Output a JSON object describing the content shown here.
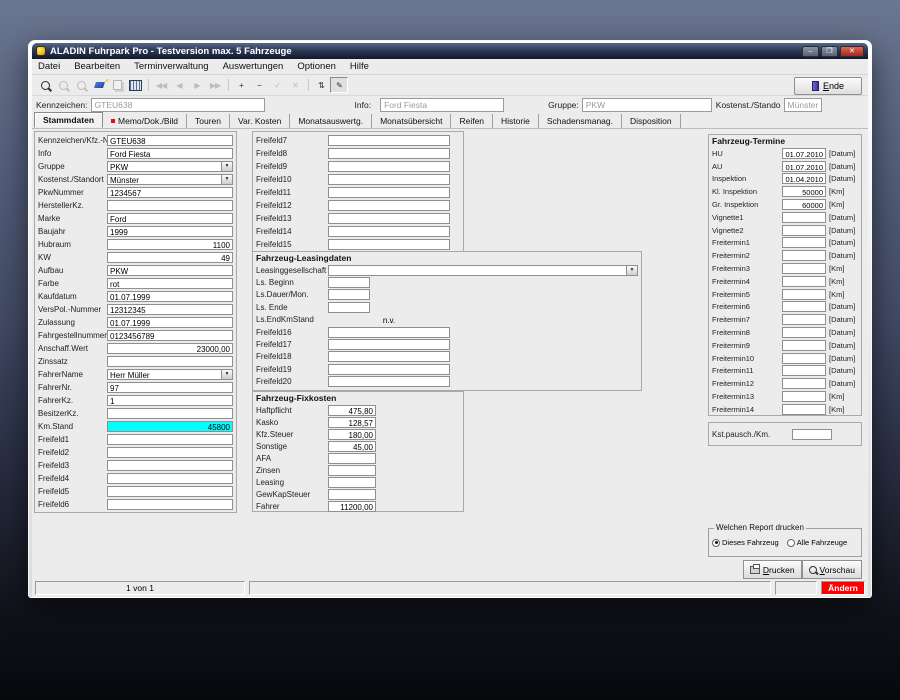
{
  "colors": {
    "highlight_field": "#00ffff",
    "mode_badge_bg": "#ff0000",
    "titlebar_dark": "#10182a",
    "tab_marker_red": "#dd1111"
  },
  "window": {
    "title": "ALADIN Fuhrpark Pro - Testversion  max. 5 Fahrzeuge",
    "minimize_glyph": "–",
    "maximize_glyph": "❐",
    "close_glyph": "✕"
  },
  "menu": {
    "items": [
      {
        "label": "Datei"
      },
      {
        "label": "Bearbeiten"
      },
      {
        "label": "Terminverwaltung"
      },
      {
        "label": "Auswertungen"
      },
      {
        "label": "Optionen"
      },
      {
        "label": "Hilfe"
      }
    ]
  },
  "toolbar": {
    "items": [
      {
        "name": "search-button",
        "icon": "magnifier",
        "enabled": true
      },
      {
        "name": "find-next-button",
        "icon": "magnifier",
        "enabled": false
      },
      {
        "name": "find-record-button",
        "icon": "magnifier",
        "enabled": false
      },
      {
        "name": "erase-button",
        "icon": "eraser",
        "enabled": true
      },
      {
        "name": "copy-button",
        "icon": "copy",
        "enabled": false
      },
      {
        "name": "table-button",
        "icon": "grid",
        "enabled": true
      },
      {
        "sep": true
      },
      {
        "name": "nav-first-button",
        "glyph": "◀◀",
        "enabled": false
      },
      {
        "name": "nav-prev-button",
        "glyph": "◀",
        "enabled": false
      },
      {
        "name": "nav-next-button",
        "glyph": "▶",
        "enabled": false
      },
      {
        "name": "nav-last-button",
        "glyph": "▶▶",
        "enabled": false
      },
      {
        "sep": true
      },
      {
        "name": "add-record-button",
        "glyph": "+",
        "enabled": true
      },
      {
        "name": "delete-record-button",
        "glyph": "−",
        "enabled": true
      },
      {
        "name": "confirm-button",
        "glyph": "✓",
        "enabled": false
      },
      {
        "name": "cancel-button",
        "glyph": "✕",
        "enabled": false
      },
      {
        "sep": true
      },
      {
        "name": "exchange-button",
        "glyph": "⇅",
        "enabled": true
      },
      {
        "name": "edit-mode-button",
        "glyph": "✎",
        "enabled": true,
        "pressed": true
      }
    ],
    "ende_button": {
      "hotkey": "E",
      "rest": "nde"
    }
  },
  "header_fields": [
    {
      "label": "Kennzeichen:",
      "value": "GTEU638"
    },
    {
      "label": "Info:",
      "value": "Ford Fiesta"
    },
    {
      "label": "Gruppe:",
      "value": "PKW"
    },
    {
      "label": "Kostenst./Stando",
      "value": "Münster"
    }
  ],
  "tabs": [
    {
      "label": "Stammdaten",
      "active": true
    },
    {
      "label": "Memo/Dok./Bild",
      "marker": true
    },
    {
      "label": "Touren"
    },
    {
      "label": "Var. Kosten"
    },
    {
      "label": "Monatsauswertg."
    },
    {
      "label": "Monatsübersicht"
    },
    {
      "label": "Reifen"
    },
    {
      "label": "Historie"
    },
    {
      "label": "Schadensmanag."
    },
    {
      "label": "Disposition"
    }
  ],
  "stammdaten": {
    "rows": [
      {
        "label": "Kennzeichen/Kfz.-Nr.",
        "value": "GTEU638"
      },
      {
        "label": "Info",
        "value": "Ford Fiesta"
      },
      {
        "label": "Gruppe",
        "value": "PKW",
        "type": "dropdown"
      },
      {
        "label": "Kostenst./Standort",
        "value": "Münster",
        "type": "dropdown"
      },
      {
        "label": "PkwNummer",
        "value": "1234567"
      },
      {
        "label": "HerstellerKz.",
        "value": ""
      },
      {
        "label": "Marke",
        "value": "Ford"
      },
      {
        "label": "Baujahr",
        "value": "1999"
      },
      {
        "label": "Hubraum",
        "value": "1100",
        "align": "right"
      },
      {
        "label": "KW",
        "value": "49",
        "align": "right"
      },
      {
        "label": "Aufbau",
        "value": "PKW"
      },
      {
        "label": "Farbe",
        "value": "rot"
      },
      {
        "label": "Kaufdatum",
        "value": "01.07.1999"
      },
      {
        "label": "VersPol.-Nummer",
        "value": "12312345"
      },
      {
        "label": "Zulassung",
        "value": "01.07.1999"
      },
      {
        "label": "Fahrgestellnummer",
        "value": "0123456789"
      },
      {
        "label": "Anschaff.Wert",
        "value": "23000,00",
        "align": "right"
      },
      {
        "label": "Zinssatz",
        "value": ""
      },
      {
        "label": "FahrerName",
        "value": "Herr Müller",
        "type": "dropdown"
      },
      {
        "label": "FahrerNr.",
        "value": "97"
      },
      {
        "label": "FahrerKz.",
        "value": "1"
      },
      {
        "label": "BesitzerKz.",
        "value": ""
      },
      {
        "label": "Km.Stand",
        "value": "45800",
        "align": "right",
        "highlight": true
      },
      {
        "label": "Freifeld1",
        "value": ""
      },
      {
        "label": "Freifeld2",
        "value": ""
      },
      {
        "label": "Freifeld3",
        "value": ""
      },
      {
        "label": "Freifeld4",
        "value": ""
      },
      {
        "label": "Freifeld5",
        "value": ""
      },
      {
        "label": "Freifeld6",
        "value": ""
      }
    ]
  },
  "freifelder": {
    "rows": [
      {
        "label": "Freifeld7",
        "value": ""
      },
      {
        "label": "Freifeld8",
        "value": ""
      },
      {
        "label": "Freifeld9",
        "value": ""
      },
      {
        "label": "Freifeld10",
        "value": ""
      },
      {
        "label": "Freifeld11",
        "value": ""
      },
      {
        "label": "Freifeld12",
        "value": ""
      },
      {
        "label": "Freifeld13",
        "value": ""
      },
      {
        "label": "Freifeld14",
        "value": ""
      },
      {
        "label": "Freifeld15",
        "value": ""
      }
    ]
  },
  "leasing": {
    "title": "Fahrzeug-Leasingdaten",
    "rows": [
      {
        "label": "Leasinggesellschaft",
        "value": "",
        "type": "dropdown",
        "size": "wide"
      },
      {
        "label": "Ls. Beginn",
        "value": "",
        "size": "small"
      },
      {
        "label": "Ls.Dauer/Mon.",
        "value": "",
        "size": "small"
      },
      {
        "label": "Ls. Ende",
        "value": "",
        "size": "small"
      },
      {
        "label": "Ls.EndKmStand",
        "value": "n.v.",
        "type": "plain"
      },
      {
        "label": "Freifeld16",
        "value": ""
      },
      {
        "label": "Freifeld17",
        "value": ""
      },
      {
        "label": "Freifeld18",
        "value": ""
      },
      {
        "label": "Freifeld19",
        "value": ""
      },
      {
        "label": "Freifeld20",
        "value": ""
      }
    ]
  },
  "fixkosten": {
    "title": "Fahrzeug-Fixkosten",
    "rows": [
      {
        "label": "Haftpflicht",
        "value": "475,80"
      },
      {
        "label": "Kasko",
        "value": "128,57"
      },
      {
        "label": "Kfz.Steuer",
        "value": "180,00"
      },
      {
        "label": "Sonstige",
        "value": "45,00"
      },
      {
        "label": "AFA",
        "value": ""
      },
      {
        "label": "Zinsen",
        "value": ""
      },
      {
        "label": "Leasing",
        "value": ""
      },
      {
        "label": "GewKapSteuer",
        "value": ""
      },
      {
        "label": "Fahrer",
        "value": "11200,00"
      }
    ]
  },
  "termine": {
    "title": "Fahrzeug-Termine",
    "rows": [
      {
        "label": "HU",
        "value": "01.07.2010",
        "unit": "[Datum]"
      },
      {
        "label": "AU",
        "value": "01.07.2010",
        "unit": "[Datum]"
      },
      {
        "label": "Inspektion",
        "value": "01.04.2010",
        "unit": "[Datum]"
      },
      {
        "label": "Kl. Inspektion",
        "value": "50000",
        "unit": "[Km]"
      },
      {
        "label": "Gr. Inspektion",
        "value": "60000",
        "unit": "[Km]"
      },
      {
        "label": "Vignette1",
        "value": "",
        "unit": "[Datum]"
      },
      {
        "label": "Vignette2",
        "value": "",
        "unit": "[Datum]"
      },
      {
        "label": "Freitermin1",
        "value": "",
        "unit": "[Datum]"
      },
      {
        "label": "Freitermin2",
        "value": "",
        "unit": "[Datum]"
      },
      {
        "label": "Freitermin3",
        "value": "",
        "unit": "[Km]"
      },
      {
        "label": "Freitermin4",
        "value": "",
        "unit": "[Km]"
      },
      {
        "label": "Freitermin5",
        "value": "",
        "unit": "[Km]"
      },
      {
        "label": "Freitermin6",
        "value": "",
        "unit": "[Datum]"
      },
      {
        "label": "Freitermin7",
        "value": "",
        "unit": "[Datum]"
      },
      {
        "label": "Freitermin8",
        "value": "",
        "unit": "[Datum]"
      },
      {
        "label": "Freitermin9",
        "value": "",
        "unit": "[Datum]"
      },
      {
        "label": "Freitermin10",
        "value": "",
        "unit": "[Datum]"
      },
      {
        "label": "Freitermin11",
        "value": "",
        "unit": "[Datum]"
      },
      {
        "label": "Freitermin12",
        "value": "",
        "unit": "[Datum]"
      },
      {
        "label": "Freitermin13",
        "value": "",
        "unit": "[Km]"
      },
      {
        "label": "Freitermin14",
        "value": "",
        "unit": "[Km]"
      }
    ]
  },
  "kst_pauschale": {
    "label": "Kst.pausch./Km.",
    "value": ""
  },
  "report": {
    "title": "Welchen Report drucken",
    "options": [
      {
        "label": "Dieses Fahrzeug",
        "checked": true
      },
      {
        "label": "Alle Fahrzeuge",
        "checked": false
      }
    ]
  },
  "buttons": {
    "drucken": {
      "hotkey": "D",
      "rest": "rucken"
    },
    "vorschau": {
      "hotkey": "V",
      "rest": "orschau"
    }
  },
  "statusbar": {
    "record_indicator": "1 von 1",
    "mode": "Ändern"
  }
}
